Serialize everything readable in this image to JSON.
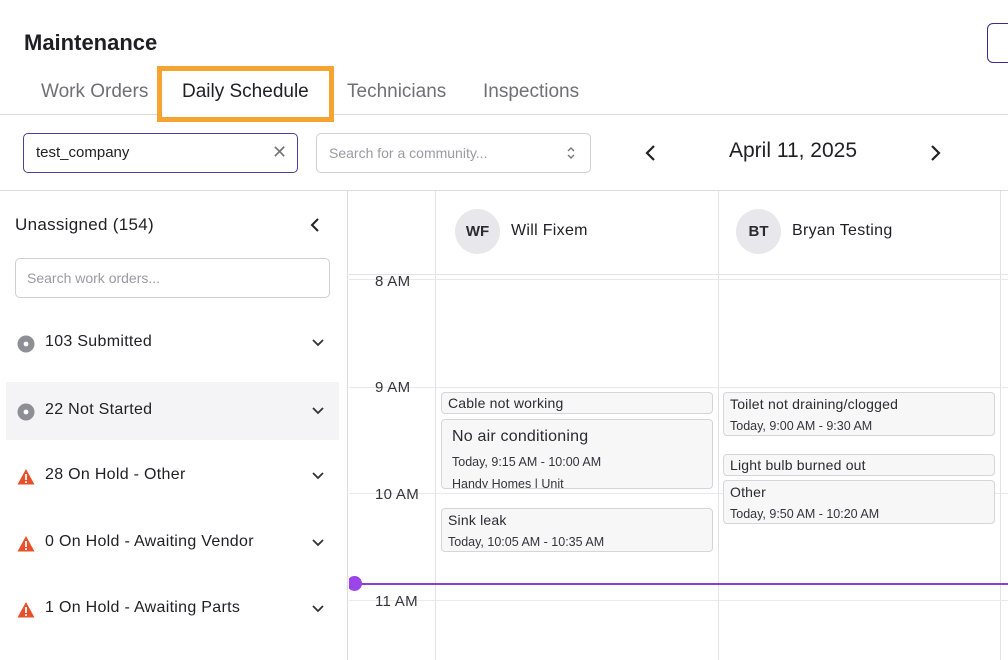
{
  "app": {
    "title": "Maintenance"
  },
  "tabs": [
    {
      "label": "Work Orders"
    },
    {
      "label": "Daily Schedule"
    },
    {
      "label": "Technicians"
    },
    {
      "label": "Inspections"
    }
  ],
  "active_tab": "Daily Schedule",
  "filters": {
    "company_value": "test_company",
    "community_placeholder": "Search for a community...",
    "date": "April 11, 2025"
  },
  "sidebar": {
    "title": "Unassigned (154)",
    "search_placeholder": "Search work orders...",
    "statuses": [
      {
        "label": "103 Submitted",
        "icon": "gray-dot-icon"
      },
      {
        "label": "22 Not Started",
        "icon": "gray-dot-icon"
      },
      {
        "label": "28 On Hold - Other",
        "icon": "warning-icon"
      },
      {
        "label": "0 On Hold - Awaiting Vendor",
        "icon": "warning-icon"
      },
      {
        "label": "1 On Hold - Awaiting Parts",
        "icon": "warning-icon"
      }
    ]
  },
  "calendar": {
    "hours": [
      "8 AM",
      "9 AM",
      "10 AM",
      "11 AM"
    ],
    "technicians": [
      {
        "initials": "WF",
        "name": "Will Fixem"
      },
      {
        "initials": "BT",
        "name": "Bryan Testing"
      }
    ],
    "events": [
      {
        "title": "Cable not working",
        "time": ""
      },
      {
        "title": "No air conditioning",
        "time": "Today, 9:15 AM - 10:00 AM",
        "extra": "Handy Homes | Unit"
      },
      {
        "title": "Sink leak",
        "time": "Today, 10:05 AM - 10:35 AM"
      },
      {
        "title": "Toilet not draining/clogged",
        "time": "Today, 9:00 AM - 9:30 AM"
      },
      {
        "title": "Light bulb burned out",
        "time": ""
      },
      {
        "title": "Other",
        "time": "Today, 9:50 AM - 10:20 AM"
      }
    ]
  },
  "colors": {
    "accent": "#4a3fa0",
    "highlight": "#f5a431",
    "now_line": "#8a3fd6",
    "warning": "#e8502a"
  }
}
